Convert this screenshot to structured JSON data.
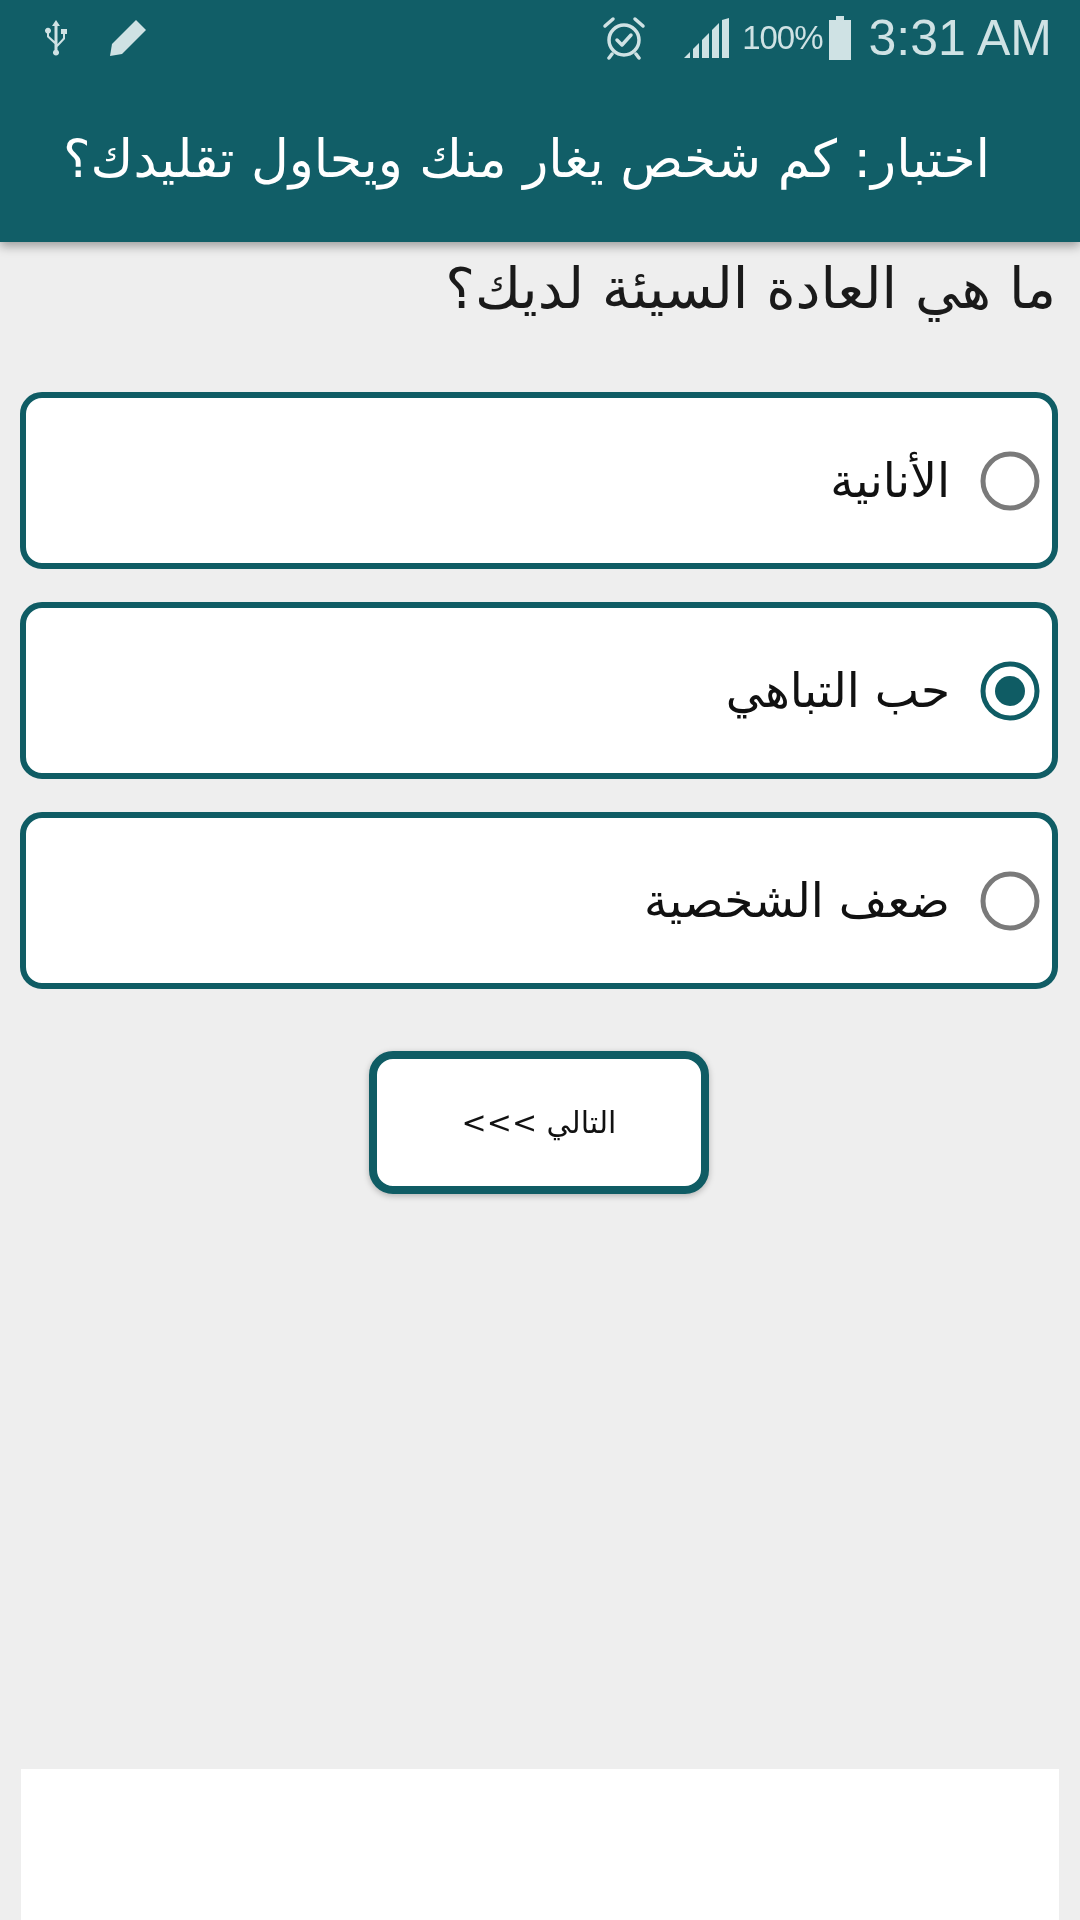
{
  "status_bar": {
    "battery_text": "100%",
    "time": "3:31 AM"
  },
  "app_bar": {
    "title": "اختبار: كم شخص يغار منك ويحاول تقليدك؟"
  },
  "question": "ما هي العادة السيئة لديك؟",
  "options": [
    {
      "label": "الأنانية",
      "selected": false
    },
    {
      "label": "حب التباهي",
      "selected": true
    },
    {
      "label": "ضعف الشخصية",
      "selected": false
    }
  ],
  "next_button": {
    "label": "التالي >>>"
  }
}
